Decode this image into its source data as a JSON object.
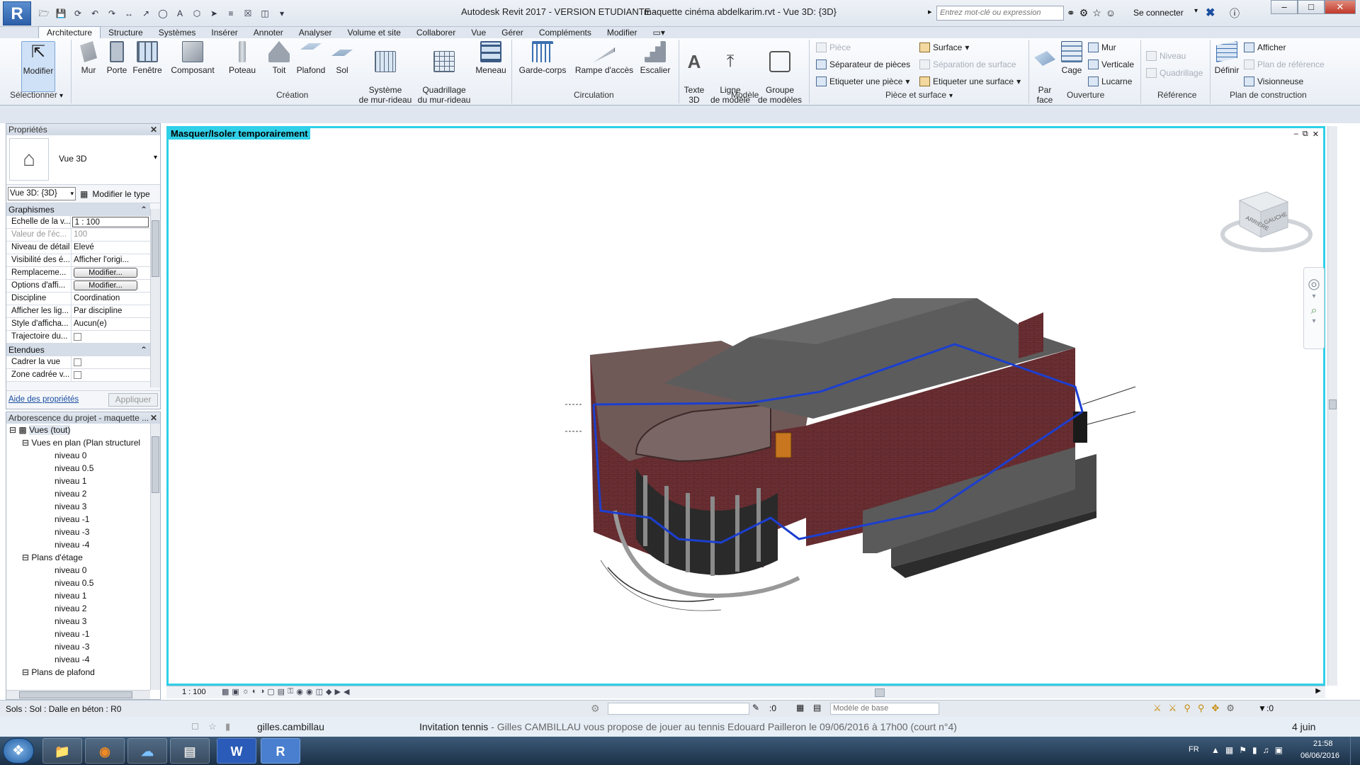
{
  "app": {
    "logo": "R",
    "title": "Autodesk Revit 2017 - VERSION ETUDIANTE -",
    "file_title": "maquette cinéma abdelkarim.rvt - Vue 3D: {3D}",
    "search_placeholder": "Entrez mot-clé ou expression",
    "login": "Se connecter"
  },
  "tabs": [
    "Architecture",
    "Structure",
    "Systèmes",
    "Insérer",
    "Annoter",
    "Analyser",
    "Volume et site",
    "Collaborer",
    "Vue",
    "Gérer",
    "Compléments",
    "Modifier"
  ],
  "ribbon": {
    "select": {
      "modify": "Modifier",
      "panel": "Sélectionner"
    },
    "creation": {
      "panel": "Création",
      "buttons": [
        "Mur",
        "Porte",
        "Fenêtre",
        "Composant",
        "Poteau",
        "Toit",
        "Plafond",
        "Sol",
        "Système\nde mur-rideau",
        "Quadrillage\ndu mur-rideau",
        "Meneau"
      ]
    },
    "circulation": {
      "panel": "Circulation",
      "buttons": [
        "Garde-corps",
        "Rampe d'accès",
        "Escalier"
      ]
    },
    "modele": {
      "panel": "Modèle",
      "buttons": [
        "Texte\n3D",
        "Ligne\nde modèle",
        "Groupe\nde modèles"
      ]
    },
    "piece": {
      "panel": "Pièce et surface",
      "piece": "Pièce",
      "separateur": "Séparateur de pièces",
      "etiquette_piece": "Etiqueter une pièce",
      "surface": "Surface",
      "separation_surface": "Séparation de surface",
      "etiquette_surface": "Etiqueter une surface"
    },
    "ouverture": {
      "panel": "Ouverture",
      "par_face": "Par\nface",
      "cage": "Cage",
      "mur": "Mur",
      "verticale": "Verticale",
      "lucarne": "Lucarne"
    },
    "reference": {
      "panel": "Référence",
      "niveau": "Niveau",
      "quadrillage": "Quadrillage"
    },
    "plan": {
      "panel": "Plan de construction",
      "definir": "Définir",
      "afficher": "Afficher",
      "plan_reference": "Plan de référence",
      "visionneuse": "Visionneuse"
    }
  },
  "properties": {
    "title": "Propriétés",
    "type_name": "Vue 3D",
    "selector": "Vue 3D: {3D}",
    "edit_type": "Modifier le type",
    "groups": [
      {
        "name": "Graphismes",
        "rows": [
          {
            "k": "Echelle de la v...",
            "v": "1 : 100"
          },
          {
            "k": "Valeur de l'éc...",
            "v": "100"
          },
          {
            "k": "Niveau de détail",
            "v": "Elevé"
          },
          {
            "k": "Visibilité des é...",
            "v": "Afficher l'origi..."
          },
          {
            "k": "Remplaceme...",
            "v": "Modifier..."
          },
          {
            "k": "Options d'affi...",
            "v": "Modifier..."
          },
          {
            "k": "Discipline",
            "v": "Coordination"
          },
          {
            "k": "Afficher les lig...",
            "v": "Par discipline"
          },
          {
            "k": "Style d'afficha...",
            "v": "Aucun(e)"
          },
          {
            "k": "Trajectoire du...",
            "v": ""
          }
        ]
      },
      {
        "name": "Etendues",
        "rows": [
          {
            "k": "Cadrer la vue",
            "v": ""
          },
          {
            "k": "Zone cadrée v...",
            "v": ""
          }
        ]
      }
    ],
    "help_link": "Aide des propriétés",
    "apply": "Appliquer"
  },
  "browser": {
    "title": "Arborescence du projet - maquette ...",
    "root": "Vues (tout)",
    "groups": [
      {
        "name": "Vues en plan (Plan structurel",
        "items": [
          "niveau 0",
          "niveau 0.5",
          "niveau 1",
          "niveau 2",
          "niveau 3",
          "niveau -1",
          "niveau -3",
          "niveau -4"
        ]
      },
      {
        "name": "Plans d'étage",
        "items": [
          "niveau 0",
          "niveau 0.5",
          "niveau 1",
          "niveau 2",
          "niveau 3",
          "niveau -1",
          "niveau -3",
          "niveau -4"
        ]
      },
      {
        "name": "Plans de plafond",
        "items": []
      }
    ]
  },
  "viewport": {
    "banner": "Masquer/Isoler temporairement",
    "scale": "1 : 100",
    "viewcube": {
      "left": "ARRIÈRE",
      "right": "GAUCHE"
    }
  },
  "status": {
    "text": "Sols : Sol : Dalle en béton : R0",
    "count": ":0",
    "model": "Modèle de base",
    "filter": ":0"
  },
  "notification": {
    "sender": "gilles.cambillau",
    "subject": "Invitation tennis",
    "body": " - Gilles CAMBILLAU vous propose de jouer au tennis Edouard Pailleron le 09/06/2016 à 17h00 (court n°4)",
    "date": "4 juin"
  },
  "taskbar": {
    "lang": "FR",
    "time": "21:58",
    "date": "06/06/2016",
    "apps": [
      "Explorateur",
      "Firefox",
      "Navigateur",
      "Application",
      "Word",
      "Revit"
    ]
  },
  "colors": {
    "accent": "#2fd0e8",
    "brick": "#6b2f33",
    "roof": "#5c5c5c",
    "path": "#1c3fd0"
  }
}
